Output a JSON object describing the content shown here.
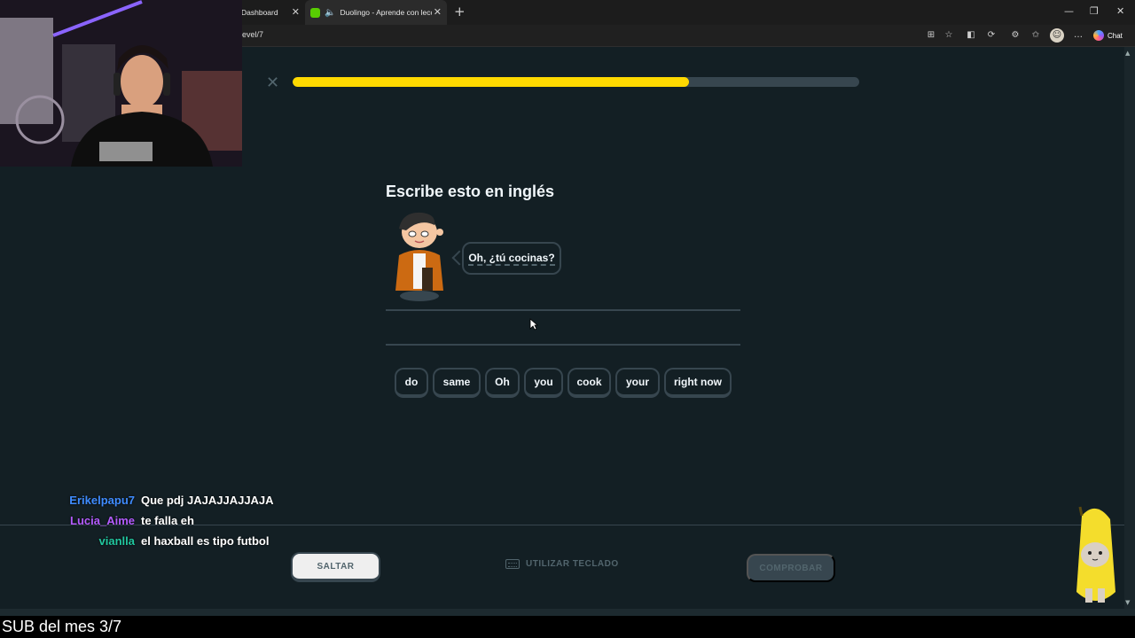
{
  "browser": {
    "tabs": [
      {
        "label": "Dashboard"
      },
      {
        "label": "Duolingo - Aprende con lecc",
        "icon": "duolingo-favicon"
      }
    ],
    "url": "level/7",
    "chat_button_label": "Chat"
  },
  "lesson": {
    "progress": 0.7,
    "progress_color": "#ffd900",
    "prompt": "Escribe esto en inglés",
    "speech_bubble": "Oh, ¿tú cocinas?",
    "word_bank": [
      "do",
      "same",
      "Oh",
      "you",
      "cook",
      "your",
      "right now"
    ],
    "skip_label": "SALTAR",
    "keyboard_label": "UTILIZAR TECLADO",
    "check_label": "COMPROBAR"
  },
  "stream": {
    "chat": [
      {
        "user": "Erikelpapu7",
        "color": "#3f8cff",
        "message": "Que pdj JAJAJJAJJAJA"
      },
      {
        "user": "Lucia_Aime",
        "color": "#b45cff",
        "message": "te falla eh"
      },
      {
        "user": "vianlla",
        "color": "#21c8a0",
        "message": "el haxball es tipo futbol"
      }
    ],
    "bottom_text": "SUB del mes 3/7"
  }
}
